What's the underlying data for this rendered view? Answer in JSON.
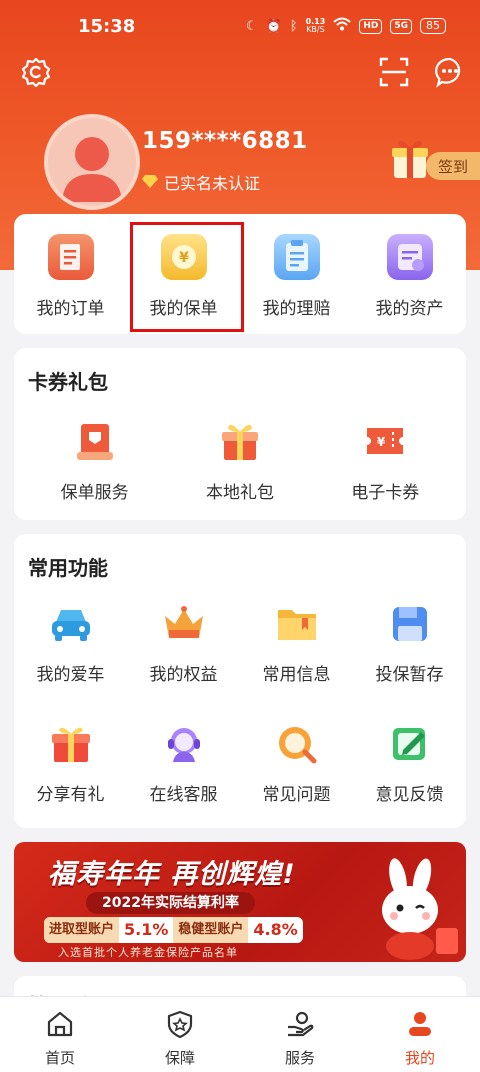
{
  "status": {
    "time": "15:38",
    "net_speed": "0.13",
    "net_unit": "KB/S",
    "hd": "HD",
    "signal": "5G",
    "battery": "85"
  },
  "user": {
    "phone": "159****6881",
    "verify_text": "已实名未认证"
  },
  "header": {
    "signin_label": "签到"
  },
  "quick": [
    {
      "label": "我的订单",
      "icon": "order-icon"
    },
    {
      "label": "我的保单",
      "icon": "policy-icon"
    },
    {
      "label": "我的理赔",
      "icon": "claim-icon"
    },
    {
      "label": "我的资产",
      "icon": "asset-icon"
    }
  ],
  "coupons": {
    "title": "卡券礼包",
    "items": [
      {
        "label": "保单服务",
        "icon": "policy-service-icon"
      },
      {
        "label": "本地礼包",
        "icon": "gift-box-icon"
      },
      {
        "label": "电子卡券",
        "icon": "ticket-icon"
      }
    ]
  },
  "functions": {
    "title": "常用功能",
    "items": [
      {
        "label": "我的爱车",
        "icon": "car-icon"
      },
      {
        "label": "我的权益",
        "icon": "crown-icon"
      },
      {
        "label": "常用信息",
        "icon": "folder-icon"
      },
      {
        "label": "投保暂存",
        "icon": "save-icon"
      },
      {
        "label": "分享有礼",
        "icon": "gift-icon"
      },
      {
        "label": "在线客服",
        "icon": "headset-icon"
      },
      {
        "label": "常见问题",
        "icon": "faq-icon"
      },
      {
        "label": "意见反馈",
        "icon": "feedback-icon"
      }
    ]
  },
  "banner": {
    "headline": "福寿年年 再创辉煌!",
    "subtitle": "2022年实际结算利率",
    "rate1_label": "进取型账户",
    "rate1_value": "5.1%",
    "rate2_label": "稳健型账户",
    "rate2_value": "4.8%",
    "footnote": "入选首批个人养老金保险产品名单"
  },
  "next_section": {
    "title": "精彩活动",
    "more": "更多"
  },
  "tabbar": [
    {
      "label": "首页",
      "icon": "home-icon"
    },
    {
      "label": "保障",
      "icon": "shield-icon"
    },
    {
      "label": "服务",
      "icon": "service-icon"
    },
    {
      "label": "我的",
      "icon": "profile-icon",
      "active": true
    }
  ],
  "colors": {
    "brand": "#e8461e",
    "highlight_box": "#e01010"
  }
}
